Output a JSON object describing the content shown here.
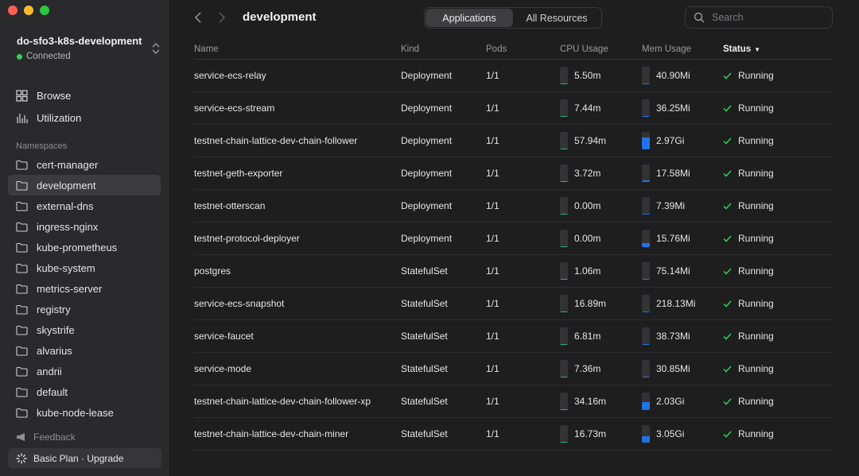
{
  "sidebar": {
    "cluster": {
      "name": "do-sfo3-k8s-development",
      "status": "Connected"
    },
    "nav": [
      {
        "label": "Browse",
        "icon": "grid-icon"
      },
      {
        "label": "Utilization",
        "icon": "bars-icon"
      }
    ],
    "namespaces_header": "Namespaces",
    "namespaces": [
      "cert-manager",
      "development",
      "external-dns",
      "ingress-nginx",
      "kube-prometheus",
      "kube-system",
      "metrics-server",
      "registry",
      "skystrife",
      "alvarius",
      "andrii",
      "default",
      "kube-node-lease"
    ],
    "active_namespace": "development",
    "feedback": "Feedback",
    "plan": "Basic Plan · Upgrade"
  },
  "toolbar": {
    "title": "development",
    "tabs": [
      {
        "label": "Applications",
        "active": true
      },
      {
        "label": "All Resources",
        "active": false
      }
    ],
    "search_placeholder": "Search"
  },
  "table": {
    "headers": {
      "name": "Name",
      "kind": "Kind",
      "pods": "Pods",
      "cpu": "CPU Usage",
      "mem": "Mem Usage",
      "status": "Status"
    },
    "rows": [
      {
        "name": "service-ecs-relay",
        "kind": "Deployment",
        "pods": "1/1",
        "cpu": "5.50m",
        "cpu_level": 0.02,
        "mem": "40.90Mi",
        "mem_level": 0.02,
        "status": "Running"
      },
      {
        "name": "service-ecs-stream",
        "kind": "Deployment",
        "pods": "1/1",
        "cpu": "7.44m",
        "cpu_level": 0.02,
        "mem": "36.25Mi",
        "mem_level": 0.02,
        "status": "Running"
      },
      {
        "name": "testnet-chain-lattice-dev-chain-follower",
        "kind": "Deployment",
        "pods": "1/1",
        "cpu": "57.94m",
        "cpu_level": 0.05,
        "mem": "2.97Gi",
        "mem_level": 0.7,
        "status": "Running"
      },
      {
        "name": "testnet-geth-exporter",
        "kind": "Deployment",
        "pods": "1/1",
        "cpu": "3.72m",
        "cpu_level": 0.02,
        "mem": "17.58Mi",
        "mem_level": 0.1,
        "status": "Running"
      },
      {
        "name": "testnet-otterscan",
        "kind": "Deployment",
        "pods": "1/1",
        "cpu": "0.00m",
        "cpu_level": 0,
        "mem": "7.39Mi",
        "mem_level": 0.04,
        "status": "Running"
      },
      {
        "name": "testnet-protocol-deployer",
        "kind": "Deployment",
        "pods": "1/1",
        "cpu": "0.00m",
        "cpu_level": 0,
        "mem": "15.76Mi",
        "mem_level": 0.25,
        "status": "Running"
      },
      {
        "name": "postgres",
        "kind": "StatefulSet",
        "pods": "1/1",
        "cpu": "1.06m",
        "cpu_level": 0.02,
        "mem": "75.14Mi",
        "mem_level": 0.02,
        "status": "Running"
      },
      {
        "name": "service-ecs-snapshot",
        "kind": "StatefulSet",
        "pods": "1/1",
        "cpu": "16.89m",
        "cpu_level": 0.02,
        "mem": "218.13Mi",
        "mem_level": 0.03,
        "status": "Running"
      },
      {
        "name": "service-faucet",
        "kind": "StatefulSet",
        "pods": "1/1",
        "cpu": "6.81m",
        "cpu_level": 0.02,
        "mem": "38.73Mi",
        "mem_level": 0.02,
        "status": "Running"
      },
      {
        "name": "service-mode",
        "kind": "StatefulSet",
        "pods": "1/1",
        "cpu": "7.36m",
        "cpu_level": 0.02,
        "mem": "30.85Mi",
        "mem_level": 0.02,
        "status": "Running"
      },
      {
        "name": "testnet-chain-lattice-dev-chain-follower-xp",
        "kind": "StatefulSet",
        "pods": "1/1",
        "cpu": "34.16m",
        "cpu_level": 0.03,
        "mem": "2.03Gi",
        "mem_level": 0.45,
        "status": "Running"
      },
      {
        "name": "testnet-chain-lattice-dev-chain-miner",
        "kind": "StatefulSet",
        "pods": "1/1",
        "cpu": "16.73m",
        "cpu_level": 0.02,
        "mem": "3.05Gi",
        "mem_level": 0.35,
        "status": "Running"
      }
    ]
  },
  "colors": {
    "cpu_meter": "#2fb27c",
    "mem_meter": "#1f74e8",
    "status_ok": "#30d158",
    "connected": "#30d158"
  }
}
